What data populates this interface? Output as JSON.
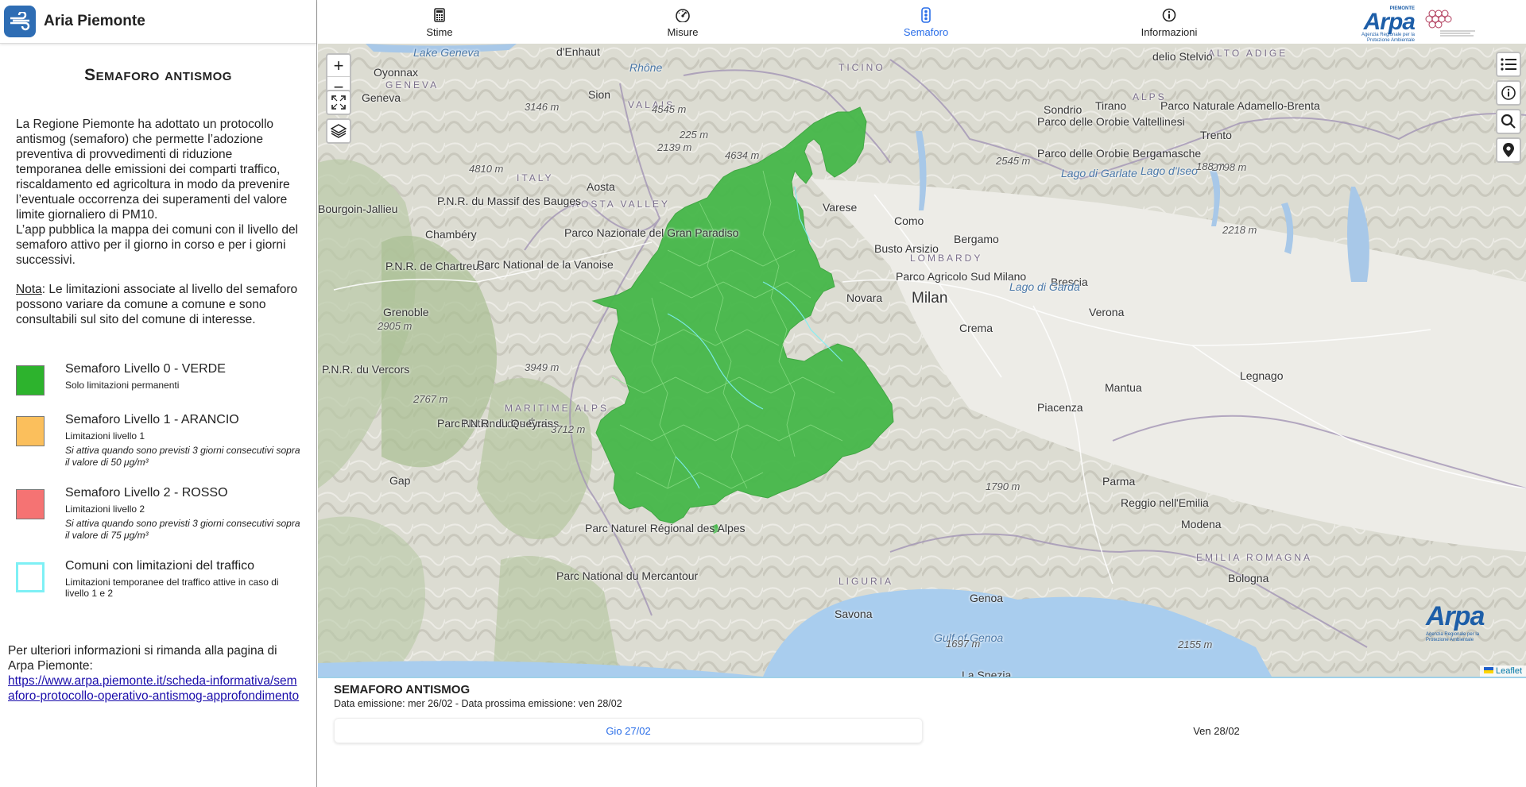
{
  "app": {
    "title": "Aria Piemonte"
  },
  "nav": {
    "tabs": [
      {
        "label": "Stime",
        "icon": "calculator-icon"
      },
      {
        "label": "Misure",
        "icon": "gauge-icon"
      },
      {
        "label": "Semaforo",
        "icon": "traffic-light-icon",
        "active": true
      },
      {
        "label": "Informazioni",
        "icon": "info-icon"
      }
    ]
  },
  "brand": {
    "arpa": "Arpa",
    "arpa_sub": "Agenzia Regionale per la Protezione Ambientale",
    "arpa_top": "PIEMONTE"
  },
  "sidebar": {
    "title": "Semaforo antismog",
    "intro_1": "La Regione Piemonte ha adottato un protocollo antismog (semaforo) che permette l’adozione preventiva di provvedimenti di riduzione temporanea delle emissioni dei comparti traffico, riscaldamento ed agricoltura in modo da prevenire l’eventuale occorrenza dei superamenti del valore limite giornaliero di PM10.",
    "intro_2": "L’app pubblica la mappa dei comuni con il livello del semaforo attivo per il giorno in corso e per i giorni successivi.",
    "nota_label": "Nota",
    "nota_text": ": Le limitazioni associate al livello del semaforo possono variare da comune a comune e sono consultabili sul sito del comune di interesse.",
    "legend": [
      {
        "title": "Semaforo Livello 0 - VERDE",
        "sub": "Solo limitazioni permanenti",
        "note": "",
        "color": "#2db32d",
        "border": "#777"
      },
      {
        "title": "Semaforo Livello 1 - ARANCIO",
        "sub": "Limitazioni livello 1",
        "note": "Si attiva quando sono previsti 3 giorni consecutivi sopra il valore di 50 μg/m³",
        "color": "#fbbf5c",
        "border": "#777"
      },
      {
        "title": "Semaforo Livello 2 - ROSSO",
        "sub": "Limitazioni livello 2",
        "note": "Si attiva quando sono previsti 3 giorni consecutivi sopra il valore di 75 μg/m³",
        "color": "#f57373",
        "border": "#777"
      },
      {
        "title": "Comuni con limitazioni del traffico",
        "sub": "Limitazioni temporanee del traffico attive in caso di livello 1 e 2",
        "note": "",
        "color": "#ffffff",
        "border": "#7ef0f5"
      }
    ],
    "more_info": "Per ulteriori informazioni si rimanda alla pagina di Arpa Piemonte:",
    "link": "https://www.arpa.piemonte.it/scheda-informativa/semaforo-protocollo-operativo-antismog-approfondimento"
  },
  "map": {
    "zoom_in": "+",
    "zoom_out": "−",
    "attribution": "Leaflet",
    "labels": [
      {
        "t": "Lake Geneva",
        "c": "water"
      },
      {
        "t": "d'Enhaut",
        "c": ""
      },
      {
        "t": "Rhône",
        "c": "water"
      },
      {
        "t": "Oyonnax",
        "c": ""
      },
      {
        "t": "Geneva",
        "c": ""
      },
      {
        "t": "GENEVA",
        "c": "region"
      },
      {
        "t": "Sion",
        "c": ""
      },
      {
        "t": "VALAIS",
        "c": "region"
      },
      {
        "t": "TICINO",
        "c": "region"
      },
      {
        "t": "3146 m",
        "c": "alt"
      },
      {
        "t": "4545 m",
        "c": "alt"
      },
      {
        "t": "225 m",
        "c": "alt"
      },
      {
        "t": "2139 m",
        "c": "alt"
      },
      {
        "t": "4634 m",
        "c": "alt"
      },
      {
        "t": "4810 m",
        "c": "alt"
      },
      {
        "t": "ITALY",
        "c": "region"
      },
      {
        "t": "Aosta",
        "c": ""
      },
      {
        "t": "AOSTA VALLEY",
        "c": "region"
      },
      {
        "t": "Bourgoin-Jallieu",
        "c": ""
      },
      {
        "t": "P.N.R. du Massif des Bauges",
        "c": ""
      },
      {
        "t": "Chambéry",
        "c": ""
      },
      {
        "t": "Parco Nazionale del Gran Paradiso",
        "c": ""
      },
      {
        "t": "P.N.R. de Chartreuse",
        "c": ""
      },
      {
        "t": "Parc National de la Vanoise",
        "c": ""
      },
      {
        "t": "Grenoble",
        "c": ""
      },
      {
        "t": "2905 m",
        "c": "alt"
      },
      {
        "t": "3949 m",
        "c": "alt"
      },
      {
        "t": "P.N.R. du Vercors",
        "c": ""
      },
      {
        "t": "2767 m",
        "c": "alt"
      },
      {
        "t": "Parc National des Écrins",
        "c": ""
      },
      {
        "t": "MARITIME ALPS",
        "c": "region"
      },
      {
        "t": "P.N.R. du Queyras",
        "c": ""
      },
      {
        "t": "3712 m",
        "c": "alt"
      },
      {
        "t": "Gap",
        "c": ""
      },
      {
        "t": "Parc Naturel Régional des Alpes",
        "c": ""
      },
      {
        "t": "Parc National du Mercantour",
        "c": ""
      },
      {
        "t": "Varese",
        "c": ""
      },
      {
        "t": "Como",
        "c": ""
      },
      {
        "t": "Busto Arsizio",
        "c": ""
      },
      {
        "t": "Bergamo",
        "c": ""
      },
      {
        "t": "LOMBARDY",
        "c": "region"
      },
      {
        "t": "Milan",
        "c": "big"
      },
      {
        "t": "Novara",
        "c": ""
      },
      {
        "t": "Parco Agricolo Sud Milano",
        "c": ""
      },
      {
        "t": "Crema",
        "c": ""
      },
      {
        "t": "Brescia",
        "c": ""
      },
      {
        "t": "Lago di Garda",
        "c": "water"
      },
      {
        "t": "Verona",
        "c": ""
      },
      {
        "t": "Mantua",
        "c": ""
      },
      {
        "t": "Legnago",
        "c": ""
      },
      {
        "t": "Piacenza",
        "c": ""
      },
      {
        "t": "Parma",
        "c": ""
      },
      {
        "t": "Reggio nell'Emilia",
        "c": ""
      },
      {
        "t": "Modena",
        "c": ""
      },
      {
        "t": "EMILIA ROMAGNA",
        "c": "region"
      },
      {
        "t": "Bologna",
        "c": ""
      },
      {
        "t": "Genoa",
        "c": ""
      },
      {
        "t": "LIGURIA",
        "c": "region"
      },
      {
        "t": "Savona",
        "c": ""
      },
      {
        "t": "Gulf of Genoa",
        "c": "water"
      },
      {
        "t": "La Spezia",
        "c": ""
      },
      {
        "t": "1790 m",
        "c": "alt"
      },
      {
        "t": "1697 m",
        "c": "alt"
      },
      {
        "t": "2155 m",
        "c": "alt"
      },
      {
        "t": "Sondrio",
        "c": ""
      },
      {
        "t": "Tirano",
        "c": ""
      },
      {
        "t": "Trento",
        "c": ""
      },
      {
        "t": "ALPS",
        "c": "region"
      },
      {
        "t": "Parco delle Orobie Valtellinesi",
        "c": ""
      },
      {
        "t": "Parco delle Orobie Bergamasche",
        "c": ""
      },
      {
        "t": "2545 m",
        "c": "alt"
      },
      {
        "t": "Lago di Garlate",
        "c": "water"
      },
      {
        "t": "Lago d'Iseo",
        "c": "water"
      },
      {
        "t": "2798 m",
        "c": "alt"
      },
      {
        "t": "2218 m",
        "c": "alt"
      },
      {
        "t": "188 m",
        "c": "alt"
      },
      {
        "t": "Parco Naturale Adamello-Brenta",
        "c": ""
      },
      {
        "t": "ALTO ADIGE",
        "c": "region"
      },
      {
        "t": "delio Stelvio",
        "c": ""
      }
    ]
  },
  "bottom": {
    "title": "SEMAFORO ANTISMOG",
    "subtitle": "Data emissione: mer 26/02 - Data prossima emissione: ven 28/02",
    "days": [
      {
        "label": "Gio 27/02",
        "active": true
      },
      {
        "label": "Ven 28/02",
        "active": false
      }
    ]
  }
}
